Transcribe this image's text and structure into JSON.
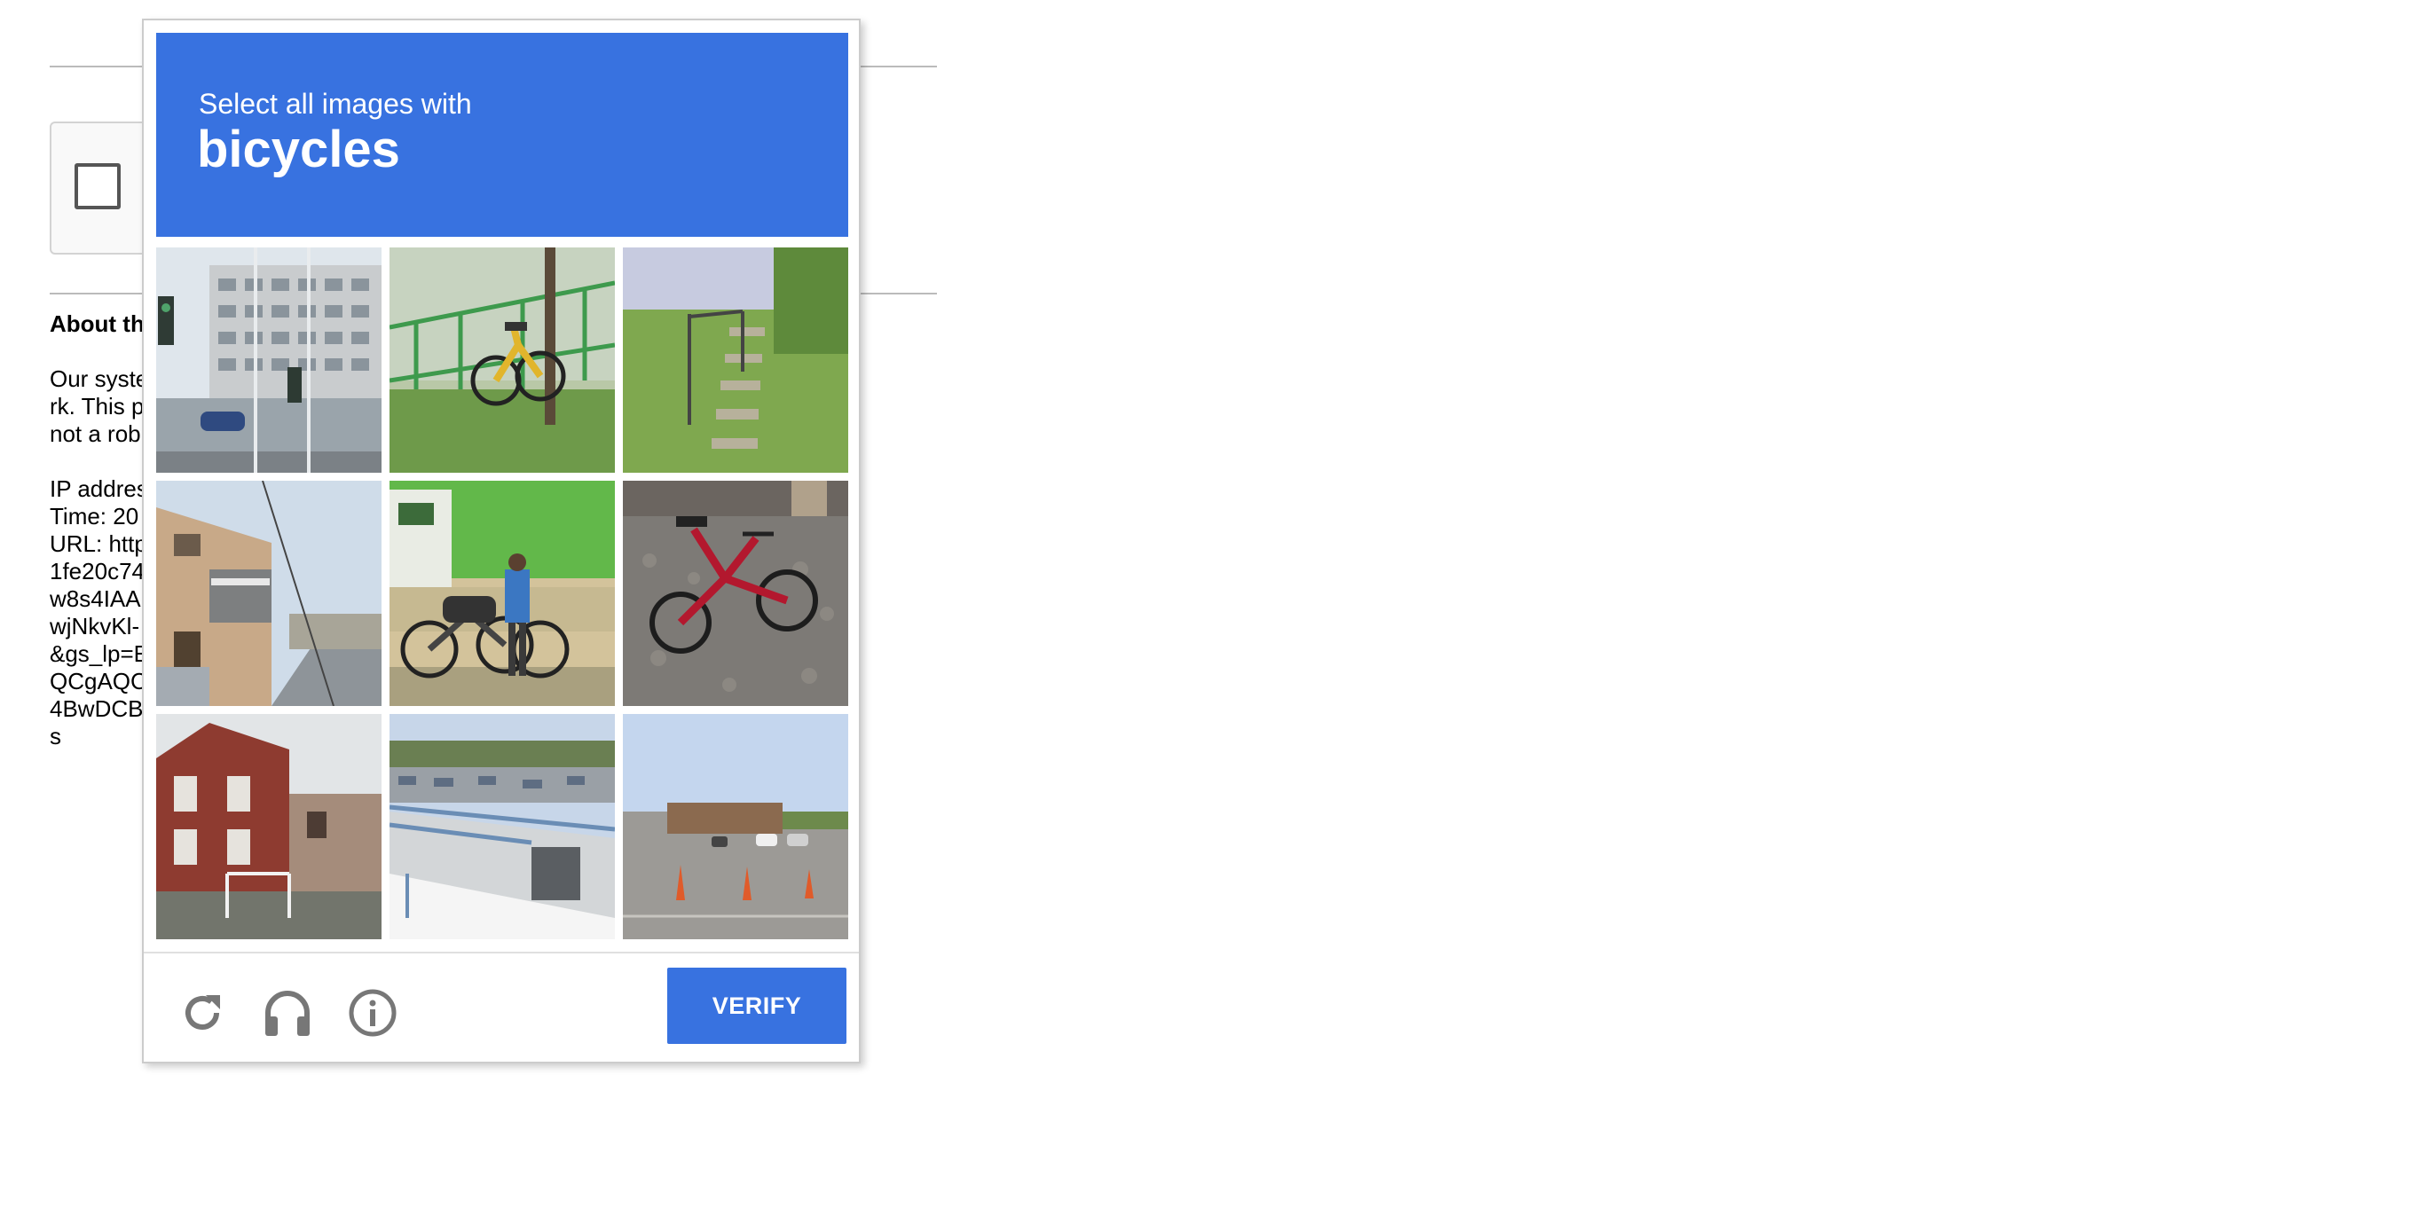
{
  "background": {
    "about_title": "About th",
    "about_lines": [
      "Our syste",
      "rk. This p",
      "not a rob",
      "",
      "IP addres",
      "Time: 20",
      "URL: http",
      "1fe20c74",
      "w8s4IAA",
      "wjNkvKl-",
      "&gs_lp=E",
      "QCgAQC",
      "4BwDCB",
      "s"
    ]
  },
  "challenge": {
    "instruction": "Select all images with",
    "target": "bicycles",
    "tiles": [
      {
        "label": "street with buildings and car"
      },
      {
        "label": "yellow bicycle by green fence"
      },
      {
        "label": "grassy slope with steps"
      },
      {
        "label": "apartment building street"
      },
      {
        "label": "bicycles by green sign"
      },
      {
        "label": "red folding bicycle"
      },
      {
        "label": "red brick house"
      },
      {
        "label": "highway overpass"
      },
      {
        "label": "parking lot with store"
      }
    ],
    "verify_label": "VERIFY",
    "icons": {
      "reload": "reload-icon",
      "audio": "headphones-icon",
      "info": "info-icon"
    },
    "colors": {
      "accent": "#3872e0",
      "icon_gray": "#777777"
    }
  }
}
